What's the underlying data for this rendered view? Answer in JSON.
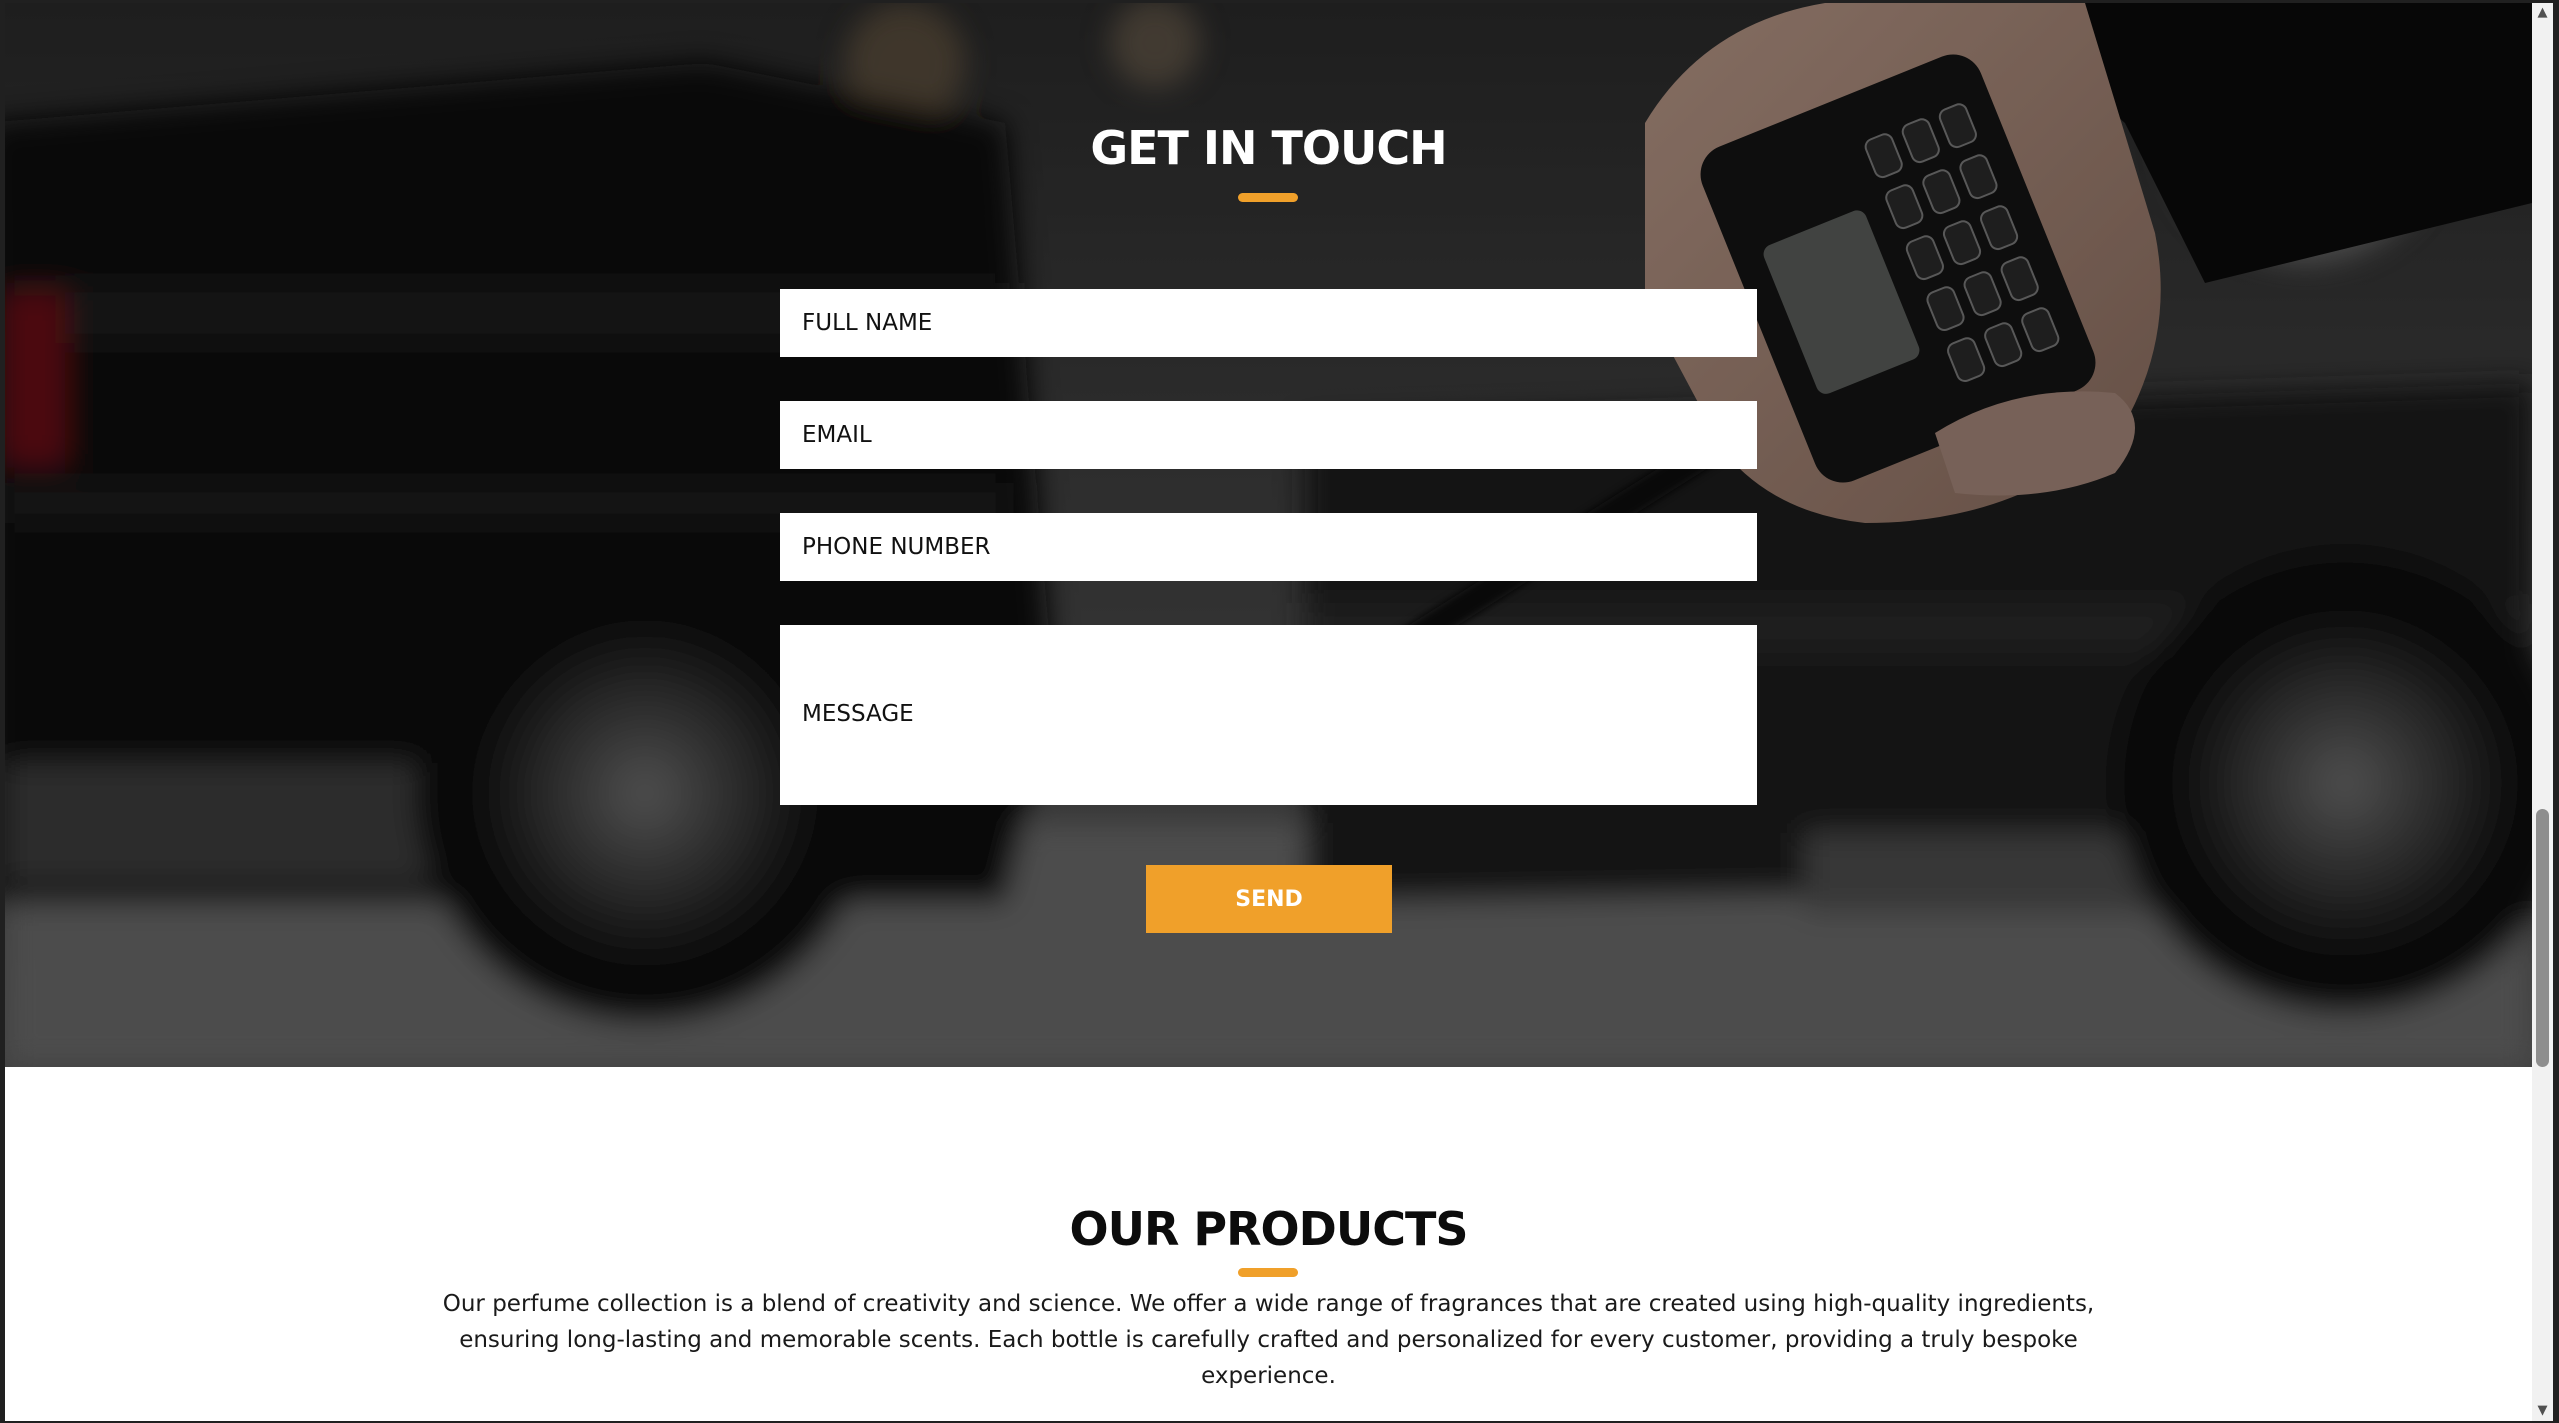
{
  "contact": {
    "title": "GET IN TOUCH",
    "full_name_placeholder": "FULL NAME",
    "email_placeholder": "EMAIL",
    "phone_placeholder": "PHONE NUMBER",
    "message_placeholder": "MESSAGE",
    "send_label": "SEND"
  },
  "products": {
    "title": "OUR PRODUCTS",
    "description": "Our perfume collection is a blend of creativity and science. We offer a wide range of fragrances that are created using high-quality ingredients, ensuring long-lasting and memorable scents. Each bottle is carefully crafted and personalized for every customer, providing a truly bespoke experience."
  },
  "scrollbar": {
    "up_icon": "triangle-up-icon",
    "down_icon": "triangle-down-icon"
  },
  "colors": {
    "accent": "#f0a02a",
    "heading_dark": "#0c0c0c",
    "hero_overlay": "#000000"
  }
}
